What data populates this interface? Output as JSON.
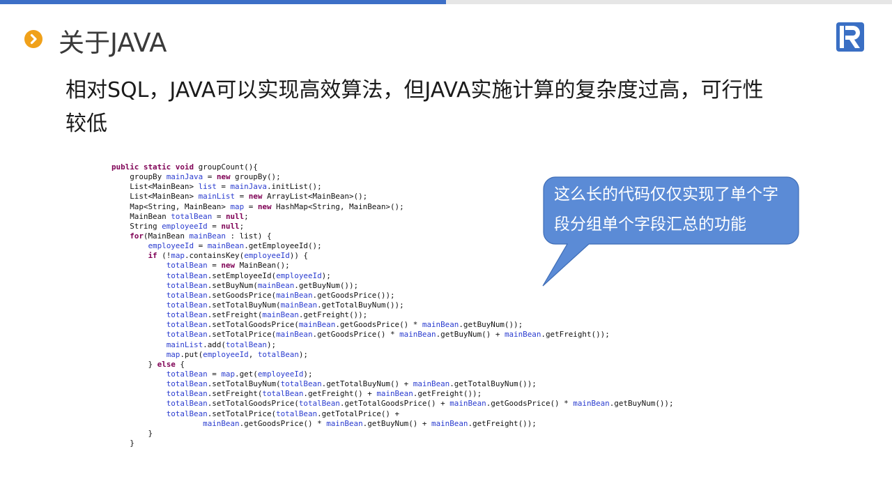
{
  "slide": {
    "title": "关于JAVA",
    "body_line1": "相对SQL，JAVA可以实现高效算法，但JAVA实施计算的复杂度过高，可行性",
    "body_line2": "较低",
    "callout_line1": "这么长的代码仅仅实现了单个字",
    "callout_line2": "段分组单个字段汇总的功能"
  },
  "logo": {
    "icon": "r-logo-icon",
    "color": "#3a6fc4"
  },
  "colors": {
    "accent": "#3d6fc7",
    "bullet": "#f0a11a",
    "callout": "#5b8bd6",
    "keyword": "#7f0055",
    "field": "#2a3ccf"
  },
  "code": [
    [
      {
        "t": "public static void",
        "c": "kw"
      },
      {
        "t": " groupCount(){"
      }
    ],
    [
      {
        "t": "    groupBy "
      },
      {
        "t": "mainJava",
        "c": "fld"
      },
      {
        "t": " = "
      },
      {
        "t": "new",
        "c": "kw"
      },
      {
        "t": " groupBy();"
      }
    ],
    [
      {
        "t": "    List<MainBean> "
      },
      {
        "t": "list",
        "c": "fld"
      },
      {
        "t": " = "
      },
      {
        "t": "mainJava",
        "c": "fld"
      },
      {
        "t": ".initList();"
      }
    ],
    [
      {
        "t": "    List<MainBean> "
      },
      {
        "t": "mainList",
        "c": "fld"
      },
      {
        "t": " = "
      },
      {
        "t": "new",
        "c": "kw"
      },
      {
        "t": " ArrayList<MainBean>();"
      }
    ],
    [
      {
        "t": "    Map<String, MainBean> "
      },
      {
        "t": "map",
        "c": "fld"
      },
      {
        "t": " = "
      },
      {
        "t": "new",
        "c": "kw"
      },
      {
        "t": " HashMap<String, MainBean>();"
      }
    ],
    [
      {
        "t": "    MainBean "
      },
      {
        "t": "totalBean",
        "c": "fld"
      },
      {
        "t": " = "
      },
      {
        "t": "null",
        "c": "kw"
      },
      {
        "t": ";"
      }
    ],
    [
      {
        "t": "    String "
      },
      {
        "t": "employeeId",
        "c": "fld"
      },
      {
        "t": " = "
      },
      {
        "t": "null",
        "c": "kw"
      },
      {
        "t": ";"
      }
    ],
    [
      {
        "t": "    "
      },
      {
        "t": "for",
        "c": "kw"
      },
      {
        "t": "(MainBean "
      },
      {
        "t": "mainBean",
        "c": "fld"
      },
      {
        "t": " : list) {"
      }
    ],
    [
      {
        "t": "        "
      },
      {
        "t": "employeeId",
        "c": "fld"
      },
      {
        "t": " = "
      },
      {
        "t": "mainBean",
        "c": "fld"
      },
      {
        "t": ".getEmployeeId();"
      }
    ],
    [
      {
        "t": "        "
      },
      {
        "t": "if",
        "c": "kw"
      },
      {
        "t": " (!"
      },
      {
        "t": "map",
        "c": "fld"
      },
      {
        "t": ".containsKey("
      },
      {
        "t": "employeeId",
        "c": "fld"
      },
      {
        "t": ")) {"
      }
    ],
    [
      {
        "t": "            "
      },
      {
        "t": "totalBean",
        "c": "fld"
      },
      {
        "t": " = "
      },
      {
        "t": "new",
        "c": "kw"
      },
      {
        "t": " MainBean();"
      }
    ],
    [
      {
        "t": "            "
      },
      {
        "t": "totalBean",
        "c": "fld"
      },
      {
        "t": ".setEmployeeId("
      },
      {
        "t": "employeeId",
        "c": "fld"
      },
      {
        "t": ");"
      }
    ],
    [
      {
        "t": "            "
      },
      {
        "t": "totalBean",
        "c": "fld"
      },
      {
        "t": ".setBuyNum("
      },
      {
        "t": "mainBean",
        "c": "fld"
      },
      {
        "t": ".getBuyNum());"
      }
    ],
    [
      {
        "t": "            "
      },
      {
        "t": "totalBean",
        "c": "fld"
      },
      {
        "t": ".setGoodsPrice("
      },
      {
        "t": "mainBean",
        "c": "fld"
      },
      {
        "t": ".getGoodsPrice());"
      }
    ],
    [
      {
        "t": "            "
      },
      {
        "t": "totalBean",
        "c": "fld"
      },
      {
        "t": ".setTotalBuyNum("
      },
      {
        "t": "mainBean",
        "c": "fld"
      },
      {
        "t": ".getTotalBuyNum());"
      }
    ],
    [
      {
        "t": "            "
      },
      {
        "t": "totalBean",
        "c": "fld"
      },
      {
        "t": ".setFreight("
      },
      {
        "t": "mainBean",
        "c": "fld"
      },
      {
        "t": ".getFreight());"
      }
    ],
    [
      {
        "t": "            "
      },
      {
        "t": "totalBean",
        "c": "fld"
      },
      {
        "t": ".setTotalGoodsPrice("
      },
      {
        "t": "mainBean",
        "c": "fld"
      },
      {
        "t": ".getGoodsPrice() * "
      },
      {
        "t": "mainBean",
        "c": "fld"
      },
      {
        "t": ".getBuyNum());"
      }
    ],
    [
      {
        "t": "            "
      },
      {
        "t": "totalBean",
        "c": "fld"
      },
      {
        "t": ".setTotalPrice("
      },
      {
        "t": "mainBean",
        "c": "fld"
      },
      {
        "t": ".getGoodsPrice() * "
      },
      {
        "t": "mainBean",
        "c": "fld"
      },
      {
        "t": ".getBuyNum() + "
      },
      {
        "t": "mainBean",
        "c": "fld"
      },
      {
        "t": ".getFreight());"
      }
    ],
    [
      {
        "t": "            "
      },
      {
        "t": "mainList",
        "c": "fld"
      },
      {
        "t": ".add("
      },
      {
        "t": "totalBean",
        "c": "fld"
      },
      {
        "t": ");"
      }
    ],
    [
      {
        "t": "            "
      },
      {
        "t": "map",
        "c": "fld"
      },
      {
        "t": ".put("
      },
      {
        "t": "employeeId",
        "c": "fld"
      },
      {
        "t": ", "
      },
      {
        "t": "totalBean",
        "c": "fld"
      },
      {
        "t": ");"
      }
    ],
    [
      {
        "t": "        } "
      },
      {
        "t": "else",
        "c": "kw"
      },
      {
        "t": " {"
      }
    ],
    [
      {
        "t": "            "
      },
      {
        "t": "totalBean",
        "c": "fld"
      },
      {
        "t": " = "
      },
      {
        "t": "map",
        "c": "fld"
      },
      {
        "t": ".get("
      },
      {
        "t": "employeeId",
        "c": "fld"
      },
      {
        "t": ");"
      }
    ],
    [
      {
        "t": "            "
      },
      {
        "t": "totalBean",
        "c": "fld"
      },
      {
        "t": ".setTotalBuyNum("
      },
      {
        "t": "totalBean",
        "c": "fld"
      },
      {
        "t": ".getTotalBuyNum() + "
      },
      {
        "t": "mainBean",
        "c": "fld"
      },
      {
        "t": ".getTotalBuyNum());"
      }
    ],
    [
      {
        "t": "            "
      },
      {
        "t": "totalBean",
        "c": "fld"
      },
      {
        "t": ".setFreight("
      },
      {
        "t": "totalBean",
        "c": "fld"
      },
      {
        "t": ".getFreight() + "
      },
      {
        "t": "mainBean",
        "c": "fld"
      },
      {
        "t": ".getFreight());"
      }
    ],
    [
      {
        "t": "            "
      },
      {
        "t": "totalBean",
        "c": "fld"
      },
      {
        "t": ".setTotalGoodsPrice("
      },
      {
        "t": "totalBean",
        "c": "fld"
      },
      {
        "t": ".getTotalGoodsPrice() + "
      },
      {
        "t": "mainBean",
        "c": "fld"
      },
      {
        "t": ".getGoodsPrice() * "
      },
      {
        "t": "mainBean",
        "c": "fld"
      },
      {
        "t": ".getBuyNum());"
      }
    ],
    [
      {
        "t": "            "
      },
      {
        "t": "totalBean",
        "c": "fld"
      },
      {
        "t": ".setTotalPrice("
      },
      {
        "t": "totalBean",
        "c": "fld"
      },
      {
        "t": ".getTotalPrice() +"
      }
    ],
    [
      {
        "t": "                    "
      },
      {
        "t": "mainBean",
        "c": "fld"
      },
      {
        "t": ".getGoodsPrice() * "
      },
      {
        "t": "mainBean",
        "c": "fld"
      },
      {
        "t": ".getBuyNum() + "
      },
      {
        "t": "mainBean",
        "c": "fld"
      },
      {
        "t": ".getFreight());"
      }
    ],
    [
      {
        "t": "        }"
      }
    ],
    [
      {
        "t": "    }"
      }
    ]
  ]
}
